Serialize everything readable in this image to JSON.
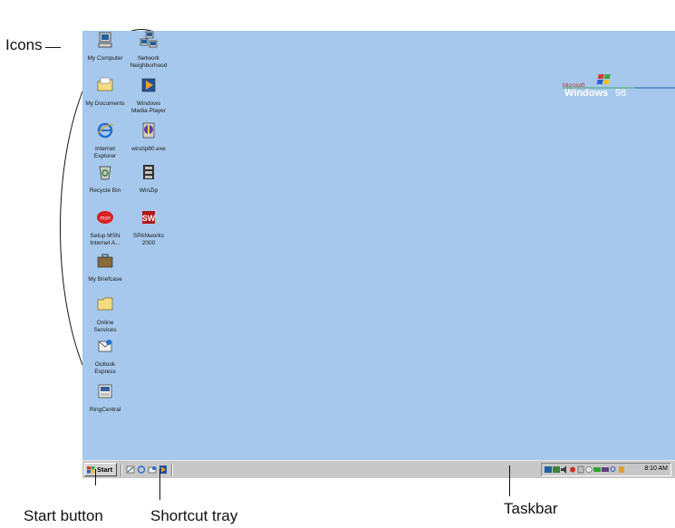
{
  "callouts": {
    "icons": "Icons",
    "start_button": "Start button",
    "shortcut_tray": "Shortcut tray",
    "taskbar": "Taskbar"
  },
  "desktop_icons": {
    "my_computer": "My Computer",
    "network_1": "Network",
    "network_2": "Neighborhood",
    "my_documents": "My Documents",
    "wmp_1": "Windows",
    "wmp_2": "Media Player",
    "ie_1": "Internet",
    "ie_2": "Explorer",
    "winzip80": "winzip80.exe",
    "recycle_bin": "Recycle Bin",
    "winzip": "WinZip",
    "msn_1": "Setup MSN",
    "msn_2": "Internet A...",
    "spanworks_1": "SPANworks",
    "spanworks_2": "2000",
    "briefcase": "My Briefcase",
    "online_1": "Online",
    "online_2": "Services",
    "outlook_1": "Outlook",
    "outlook_2": "Express",
    "ringcentral": "RingCentral"
  },
  "logo": {
    "microsoft": "Microsoft",
    "windows": "Windows",
    "version": "98"
  },
  "taskbar": {
    "start_label": "Start",
    "clock": "8:10 AM"
  }
}
